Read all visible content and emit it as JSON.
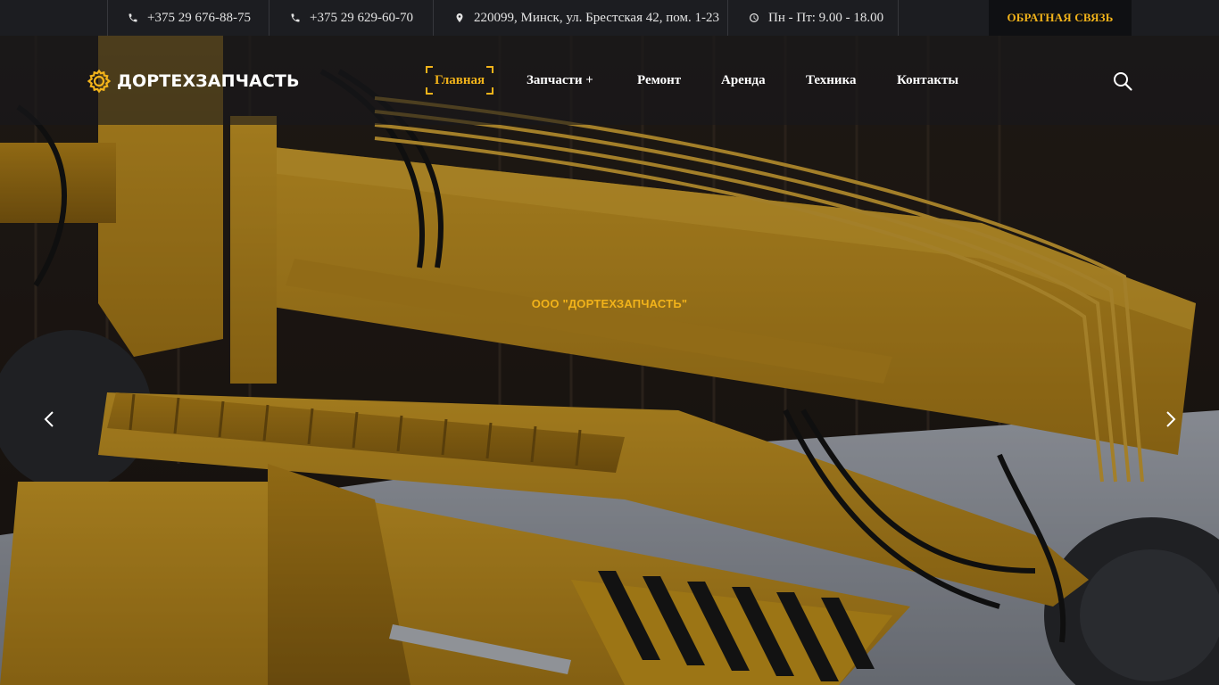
{
  "topbar": {
    "phone1": "+375 29 676-88-75",
    "phone2": "+375 29 629-60-70",
    "address": "220099, Минск, ул. Брестская 42, пом. 1-23",
    "hours": "Пн - Пт: 9.00 - 18.00",
    "feedback_label": "ОБРАТНАЯ СВЯЗЬ",
    "icons": [
      "phone-icon",
      "phone-icon",
      "map-marker-icon",
      "clock-icon"
    ]
  },
  "header": {
    "logo_text": "ДОРТЕХЗАПЧАСТЬ",
    "logo_icon": "gear-icon",
    "nav": [
      {
        "label": "Главная",
        "active": true
      },
      {
        "label": "Запчасти +",
        "active": false
      },
      {
        "label": "Ремонт",
        "active": false
      },
      {
        "label": "Аренда",
        "active": false
      },
      {
        "label": "Техника",
        "active": false
      },
      {
        "label": "Контакты",
        "active": false
      }
    ],
    "search_icon": "search-icon"
  },
  "slider": {
    "title": "ООО \"ДОРТЕХЗАПЧАСТЬ\"",
    "prev_icon": "chevron-left-icon",
    "next_icon": "chevron-right-icon"
  },
  "colors": {
    "accent": "#f2b31a",
    "topbar_bg": "#1c1d21",
    "machine_yellow": "#d9a21e"
  }
}
